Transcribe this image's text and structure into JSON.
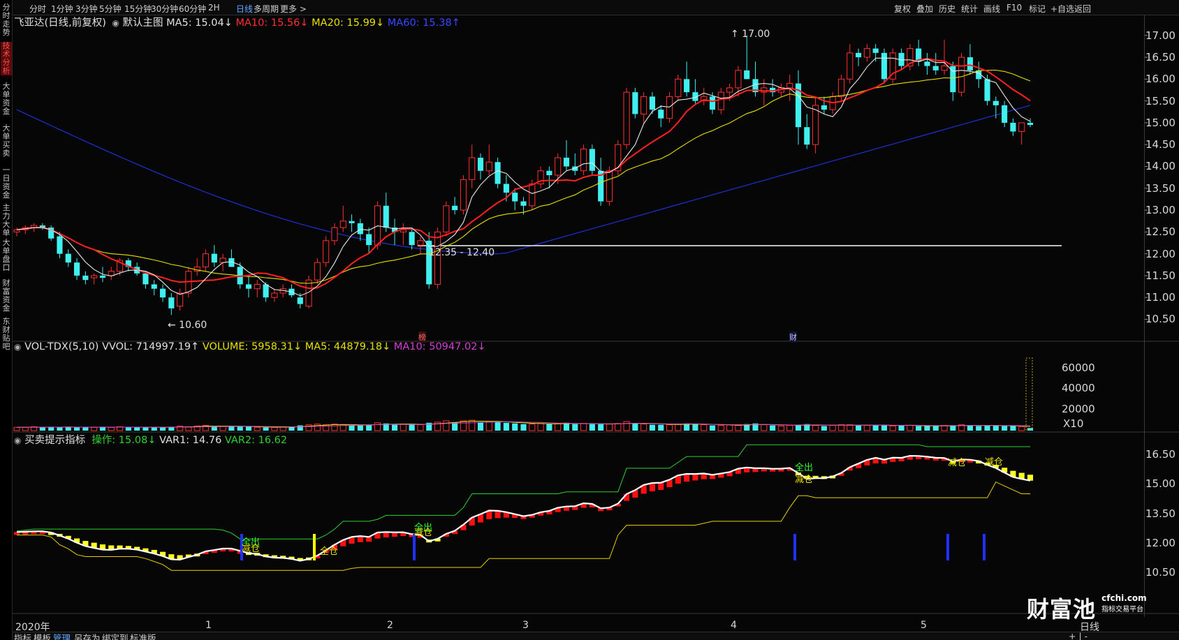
{
  "left_sidebar": [
    "分时走势",
    "技术分析",
    "大单资金",
    "大单买卖",
    "一日资金",
    "主力大单",
    "大单盘口",
    "财富资金",
    "东财贴吧"
  ],
  "left_sidebar_active": 1,
  "period_tabs": [
    "分时",
    "1分钟",
    "3分钟",
    "5分钟",
    "15分钟",
    "30分钟",
    "60分钟",
    "2H",
    "日线",
    "多周期",
    "更多 >"
  ],
  "period_active": 8,
  "toolbar_right": [
    "复权",
    "叠加",
    "历史",
    "统计",
    "画线",
    "F10",
    "标记",
    "+自选",
    "返回"
  ],
  "stock_title": "飞亚达(日线,前复权)",
  "template_label": "默认主图",
  "ma": {
    "ma5": "MA5: 15.04↓",
    "ma10": "MA10: 15.56↓",
    "ma20": "MA20: 15.99↓",
    "ma60": "MA60: 15.38↑"
  },
  "colors": {
    "up": "#ff3030",
    "down": "#40f0f0",
    "ma5": "#e8e8e8",
    "ma10": "#ff2020",
    "ma20": "#e8e000",
    "ma60": "#2030d0",
    "hline": "#bdbdbd",
    "green": "#30d030",
    "yellow": "#ffff20"
  },
  "annotations": {
    "high": "17.00",
    "low": "10.60",
    "range": "12.35 - 12.40",
    "marker1": "榜",
    "marker2": "财"
  },
  "price_axis": [
    "17.00",
    "16.50",
    "16.00",
    "15.50",
    "15.00",
    "14.50",
    "14.00",
    "13.50",
    "13.00",
    "12.50",
    "12.00",
    "11.50",
    "11.00",
    "10.50"
  ],
  "vol_legend": {
    "name": "VOL-TDX(5,10)",
    "vvol": "VVOL: 714997.19↑",
    "volume": "VOLUME: 5958.31↓",
    "ma5": "MA5: 44879.18↓",
    "ma10": "MA10: 50947.02↓"
  },
  "vol_axis": [
    "60000",
    "40000",
    "20000",
    "X10"
  ],
  "ind_legend": {
    "name": "买卖提示指标",
    "op": "操作: 15.08↓",
    "var1": "VAR1: 14.76",
    "var2": "VAR2: 16.62"
  },
  "ind_axis": [
    "16.50",
    "15.00",
    "13.50",
    "12.00",
    "10.50"
  ],
  "signals": [
    "全出",
    "减仓",
    "全仓",
    "全出",
    "减仓",
    "全出",
    "减仓",
    "减仓",
    "减仓"
  ],
  "x_axis": [
    "2020年",
    "1",
    "2",
    "3",
    "4",
    "5",
    "日线"
  ],
  "bottom_tabs": [
    "指标",
    "模板",
    "管理",
    "另存为",
    "绑定到",
    "标准版"
  ],
  "bottom_active": 2,
  "watermark": {
    "brand": "财富池",
    "site": "cfchi.com",
    "slogan": "指标交易平台"
  },
  "bottom_right": "+ | -",
  "chart_data": {
    "type": "candlestick",
    "xlabel": "",
    "ylabel": "",
    "ylim": [
      10.3,
      17.3
    ],
    "candles": [
      [
        12.5,
        12.6,
        12.4,
        12.55
      ],
      [
        12.55,
        12.65,
        12.45,
        12.6
      ],
      [
        12.6,
        12.7,
        12.5,
        12.65
      ],
      [
        12.65,
        12.7,
        12.55,
        12.6
      ],
      [
        12.6,
        12.65,
        12.3,
        12.35
      ],
      [
        12.4,
        12.5,
        11.9,
        12.0
      ],
      [
        12.0,
        12.1,
        11.7,
        11.8
      ],
      [
        11.8,
        11.9,
        11.4,
        11.5
      ],
      [
        11.5,
        11.6,
        11.3,
        11.4
      ],
      [
        11.45,
        11.55,
        11.3,
        11.5
      ],
      [
        11.5,
        11.7,
        11.35,
        11.45
      ],
      [
        11.5,
        11.7,
        11.4,
        11.6
      ],
      [
        11.6,
        11.9,
        11.5,
        11.85
      ],
      [
        11.85,
        11.9,
        11.6,
        11.7
      ],
      [
        11.7,
        11.8,
        11.5,
        11.55
      ],
      [
        11.55,
        11.6,
        11.2,
        11.3
      ],
      [
        11.3,
        11.4,
        11.05,
        11.2
      ],
      [
        11.2,
        11.3,
        10.9,
        11.0
      ],
      [
        11.0,
        11.1,
        10.6,
        10.75
      ],
      [
        10.8,
        11.2,
        10.7,
        11.1
      ],
      [
        11.1,
        11.7,
        11.0,
        11.6
      ],
      [
        11.6,
        11.9,
        11.5,
        11.7
      ],
      [
        11.7,
        12.1,
        11.6,
        12.0
      ],
      [
        12.0,
        12.2,
        11.7,
        11.8
      ],
      [
        11.8,
        12.0,
        11.6,
        11.9
      ],
      [
        11.9,
        12.1,
        11.7,
        11.7
      ],
      [
        11.7,
        11.8,
        11.2,
        11.3
      ],
      [
        11.3,
        11.5,
        11.0,
        11.2
      ],
      [
        11.2,
        11.4,
        11.0,
        11.3
      ],
      [
        11.3,
        11.35,
        10.9,
        11.0
      ],
      [
        11.0,
        11.2,
        10.9,
        11.1
      ],
      [
        11.1,
        11.3,
        11.0,
        11.2
      ],
      [
        11.2,
        11.3,
        11.0,
        11.05
      ],
      [
        11.0,
        11.1,
        10.75,
        10.85
      ],
      [
        10.8,
        11.5,
        10.75,
        11.4
      ],
      [
        11.4,
        11.9,
        11.3,
        11.8
      ],
      [
        11.8,
        12.4,
        11.7,
        12.3
      ],
      [
        12.3,
        12.7,
        12.2,
        12.6
      ],
      [
        12.6,
        13.1,
        12.5,
        12.75
      ],
      [
        12.75,
        12.9,
        12.5,
        12.7
      ],
      [
        12.7,
        12.8,
        12.3,
        12.45
      ],
      [
        12.45,
        12.6,
        12.0,
        12.2
      ],
      [
        12.2,
        13.2,
        12.1,
        13.1
      ],
      [
        13.1,
        13.4,
        12.5,
        12.6
      ],
      [
        12.6,
        12.8,
        12.2,
        12.5
      ],
      [
        12.5,
        12.7,
        12.2,
        12.55
      ],
      [
        12.5,
        12.6,
        12.1,
        12.2
      ],
      [
        12.2,
        12.4,
        12.0,
        12.3
      ],
      [
        12.3,
        12.5,
        11.2,
        11.3
      ],
      [
        11.3,
        12.6,
        11.2,
        12.5
      ],
      [
        12.5,
        13.2,
        12.4,
        13.1
      ],
      [
        13.1,
        13.3,
        12.9,
        13.0
      ],
      [
        13.0,
        13.8,
        12.9,
        13.7
      ],
      [
        13.7,
        14.5,
        13.5,
        14.2
      ],
      [
        14.2,
        14.3,
        13.7,
        13.9
      ],
      [
        13.9,
        14.5,
        13.8,
        14.1
      ],
      [
        14.1,
        14.2,
        13.5,
        13.6
      ],
      [
        13.6,
        13.8,
        13.2,
        13.4
      ],
      [
        13.4,
        13.5,
        13.0,
        13.2
      ],
      [
        13.2,
        13.3,
        12.9,
        13.1
      ],
      [
        13.1,
        13.7,
        13.0,
        13.6
      ],
      [
        13.6,
        14.0,
        13.5,
        13.9
      ],
      [
        13.9,
        14.0,
        13.5,
        13.8
      ],
      [
        13.8,
        14.3,
        13.6,
        14.2
      ],
      [
        14.2,
        14.6,
        13.9,
        14.0
      ],
      [
        14.0,
        14.3,
        13.8,
        13.9
      ],
      [
        13.9,
        14.5,
        13.8,
        14.4
      ],
      [
        14.4,
        14.5,
        13.8,
        13.9
      ],
      [
        13.9,
        14.2,
        13.1,
        13.2
      ],
      [
        13.2,
        14.0,
        13.1,
        13.9
      ],
      [
        13.9,
        14.6,
        13.8,
        14.5
      ],
      [
        14.5,
        15.8,
        14.4,
        15.7
      ],
      [
        15.7,
        15.8,
        15.1,
        15.2
      ],
      [
        15.2,
        15.7,
        15.0,
        15.6
      ],
      [
        15.6,
        15.7,
        15.2,
        15.3
      ],
      [
        15.3,
        15.4,
        14.9,
        15.1
      ],
      [
        15.1,
        15.7,
        15.0,
        15.6
      ],
      [
        15.6,
        16.1,
        15.5,
        16.0
      ],
      [
        16.0,
        16.4,
        15.6,
        15.7
      ],
      [
        15.7,
        16.0,
        15.4,
        15.5
      ],
      [
        15.5,
        15.8,
        15.4,
        15.6
      ],
      [
        15.6,
        15.7,
        15.2,
        15.3
      ],
      [
        15.3,
        15.8,
        15.2,
        15.7
      ],
      [
        15.7,
        15.9,
        15.5,
        15.8
      ],
      [
        15.8,
        16.3,
        15.6,
        16.2
      ],
      [
        16.2,
        17.0,
        16.0,
        16.0
      ],
      [
        16.0,
        16.4,
        15.6,
        15.7
      ],
      [
        15.7,
        16.0,
        15.4,
        15.8
      ],
      [
        15.8,
        16.0,
        15.6,
        15.7
      ],
      [
        15.7,
        15.9,
        15.6,
        15.8
      ],
      [
        15.8,
        16.1,
        15.5,
        15.9
      ],
      [
        15.9,
        16.2,
        14.5,
        14.9
      ],
      [
        14.9,
        15.2,
        14.4,
        14.5
      ],
      [
        14.5,
        15.6,
        14.3,
        15.4
      ],
      [
        15.4,
        15.6,
        15.2,
        15.3
      ],
      [
        15.3,
        15.7,
        15.2,
        15.6
      ],
      [
        15.6,
        16.1,
        15.5,
        16.0
      ],
      [
        16.0,
        16.8,
        15.9,
        16.6
      ],
      [
        16.6,
        16.7,
        16.3,
        16.5
      ],
      [
        16.5,
        16.8,
        16.4,
        16.7
      ],
      [
        16.7,
        16.8,
        16.4,
        16.6
      ],
      [
        16.6,
        16.7,
        15.9,
        16.0
      ],
      [
        16.0,
        16.7,
        15.9,
        16.6
      ],
      [
        16.6,
        16.7,
        16.2,
        16.3
      ],
      [
        16.3,
        16.8,
        16.2,
        16.7
      ],
      [
        16.7,
        16.9,
        16.3,
        16.4
      ],
      [
        16.4,
        16.6,
        16.1,
        16.3
      ],
      [
        16.3,
        16.6,
        16.1,
        16.2
      ],
      [
        16.2,
        16.9,
        16.1,
        16.3
      ],
      [
        16.3,
        16.4,
        15.5,
        15.7
      ],
      [
        15.7,
        16.6,
        15.6,
        16.5
      ],
      [
        16.5,
        16.8,
        16.1,
        16.2
      ],
      [
        16.2,
        16.4,
        15.8,
        16.0
      ],
      [
        16.0,
        16.1,
        15.4,
        15.5
      ],
      [
        15.5,
        15.6,
        15.1,
        15.4
      ],
      [
        15.4,
        15.5,
        14.9,
        15.0
      ],
      [
        15.0,
        15.1,
        14.7,
        14.8
      ],
      [
        14.8,
        15.0,
        14.5,
        15.0
      ],
      [
        15.0,
        15.1,
        14.9,
        14.95
      ]
    ],
    "volumes": [
      5,
      5,
      6,
      5,
      6,
      5,
      6,
      5,
      5,
      5,
      6,
      5,
      6,
      5,
      5,
      5,
      5,
      5,
      6,
      7,
      6,
      7,
      8,
      7,
      7,
      6,
      6,
      6,
      5,
      5,
      5,
      6,
      6,
      8,
      9,
      10,
      9,
      10,
      9,
      8,
      8,
      9,
      12,
      11,
      9,
      10,
      9,
      9,
      12,
      13,
      15,
      13,
      15,
      16,
      13,
      14,
      13,
      12,
      11,
      10,
      10,
      11,
      10,
      11,
      12,
      10,
      11,
      10,
      10,
      10,
      11,
      14,
      11,
      10,
      9,
      9,
      9,
      10,
      11,
      10,
      9,
      8,
      8,
      9,
      8,
      10,
      11,
      9,
      8,
      7,
      8,
      9,
      10,
      8,
      7,
      8,
      9,
      9,
      8,
      8,
      8,
      9,
      7,
      8,
      8,
      7,
      7,
      7,
      8,
      8,
      9,
      8,
      7,
      8,
      8,
      7,
      7,
      6,
      4
    ]
  }
}
